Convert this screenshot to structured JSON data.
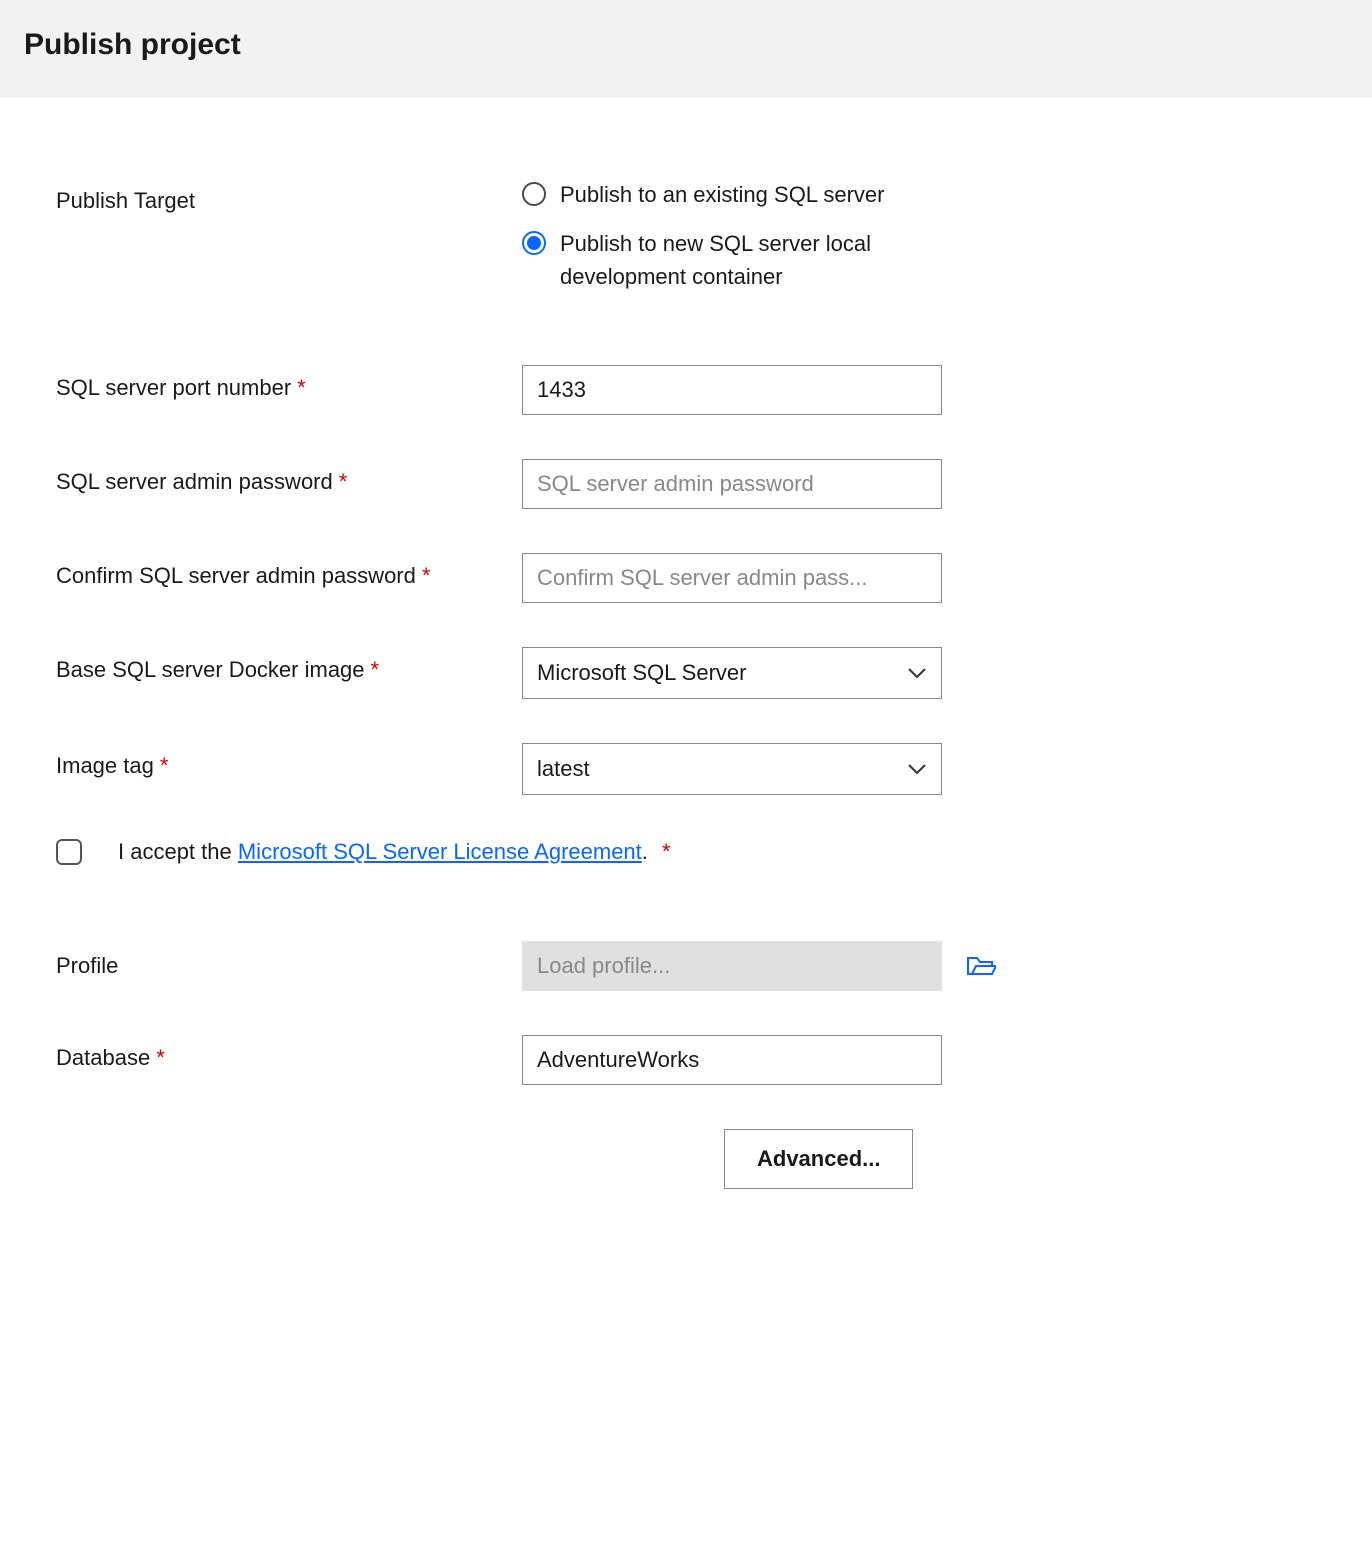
{
  "header": {
    "title": "Publish project"
  },
  "publishTarget": {
    "label": "Publish Target",
    "options": {
      "existing": "Publish to an existing SQL server",
      "newLocal": "Publish to new SQL server local development container"
    }
  },
  "port": {
    "label": "SQL server port number",
    "value": "1433"
  },
  "adminPassword": {
    "label": "SQL server admin password",
    "placeholder": "SQL server admin password"
  },
  "confirmPassword": {
    "label": "Confirm SQL server admin password",
    "placeholder": "Confirm SQL server admin pass..."
  },
  "dockerImage": {
    "label": "Base SQL server Docker image",
    "value": "Microsoft SQL Server"
  },
  "imageTag": {
    "label": "Image tag",
    "value": "latest"
  },
  "license": {
    "prefix": "I accept the ",
    "linkText": "Microsoft SQL Server License Agreement",
    "suffix": "."
  },
  "profile": {
    "label": "Profile",
    "placeholder": "Load profile..."
  },
  "database": {
    "label": "Database",
    "value": "AdventureWorks"
  },
  "advancedButton": "Advanced..."
}
